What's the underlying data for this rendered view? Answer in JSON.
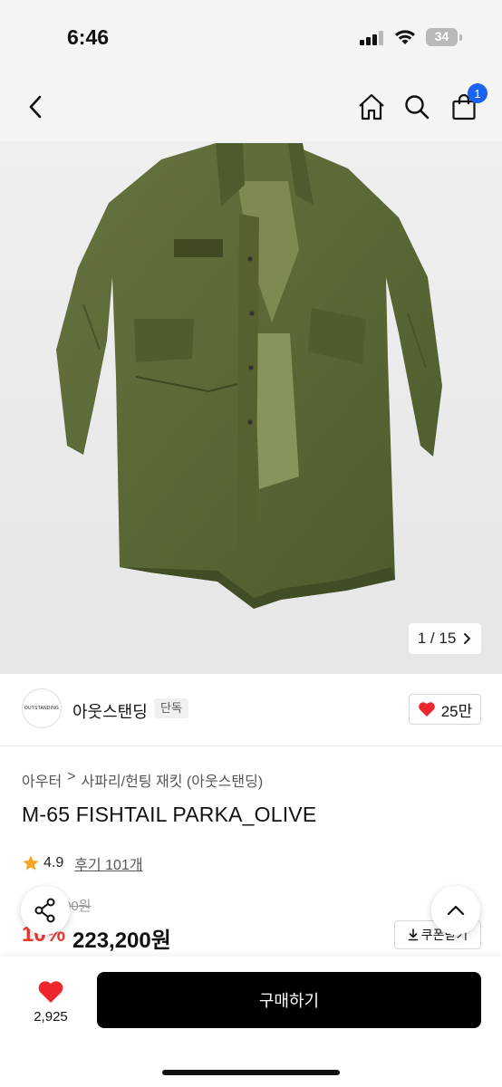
{
  "status_bar": {
    "time": "6:46",
    "battery": "34",
    "icons": [
      "cellular-signal-icon",
      "wifi-icon",
      "battery-icon"
    ]
  },
  "nav": {
    "icons": [
      "back-chevron-icon",
      "home-icon",
      "search-icon",
      "cart-icon"
    ],
    "cart_count": "1",
    "badge_color": "#1b62f0"
  },
  "gallery": {
    "current": "1",
    "separator": "/",
    "total": "15",
    "next_icon": "chevron-right-icon"
  },
  "brand": {
    "logo_text": "OUTSTANDING",
    "name": "아웃스탠딩",
    "tag": "단독",
    "likes": "25만",
    "like_icon": "heart-icon"
  },
  "product": {
    "breadcrumb": [
      "아우터",
      "사파리/헌팅 재킷 (아웃스탠딩)"
    ],
    "breadcrumb_separator": ">",
    "title": "M-65 FISHTAIL PARKA_OLIVE",
    "rating": "4.9",
    "reviews_link": "후기 101개",
    "original_price": "00원",
    "discount": "10%",
    "price": "223,200원",
    "coupon_label": "쿠폰받기",
    "discount_color": "#f0362e"
  },
  "floating": {
    "share_icon": "share-icon",
    "scroll_top_icon": "chevron-up-icon"
  },
  "bottom_bar": {
    "wish_count": "2,925",
    "buy_label": "구매하기",
    "heart_color": "#f0262e"
  }
}
